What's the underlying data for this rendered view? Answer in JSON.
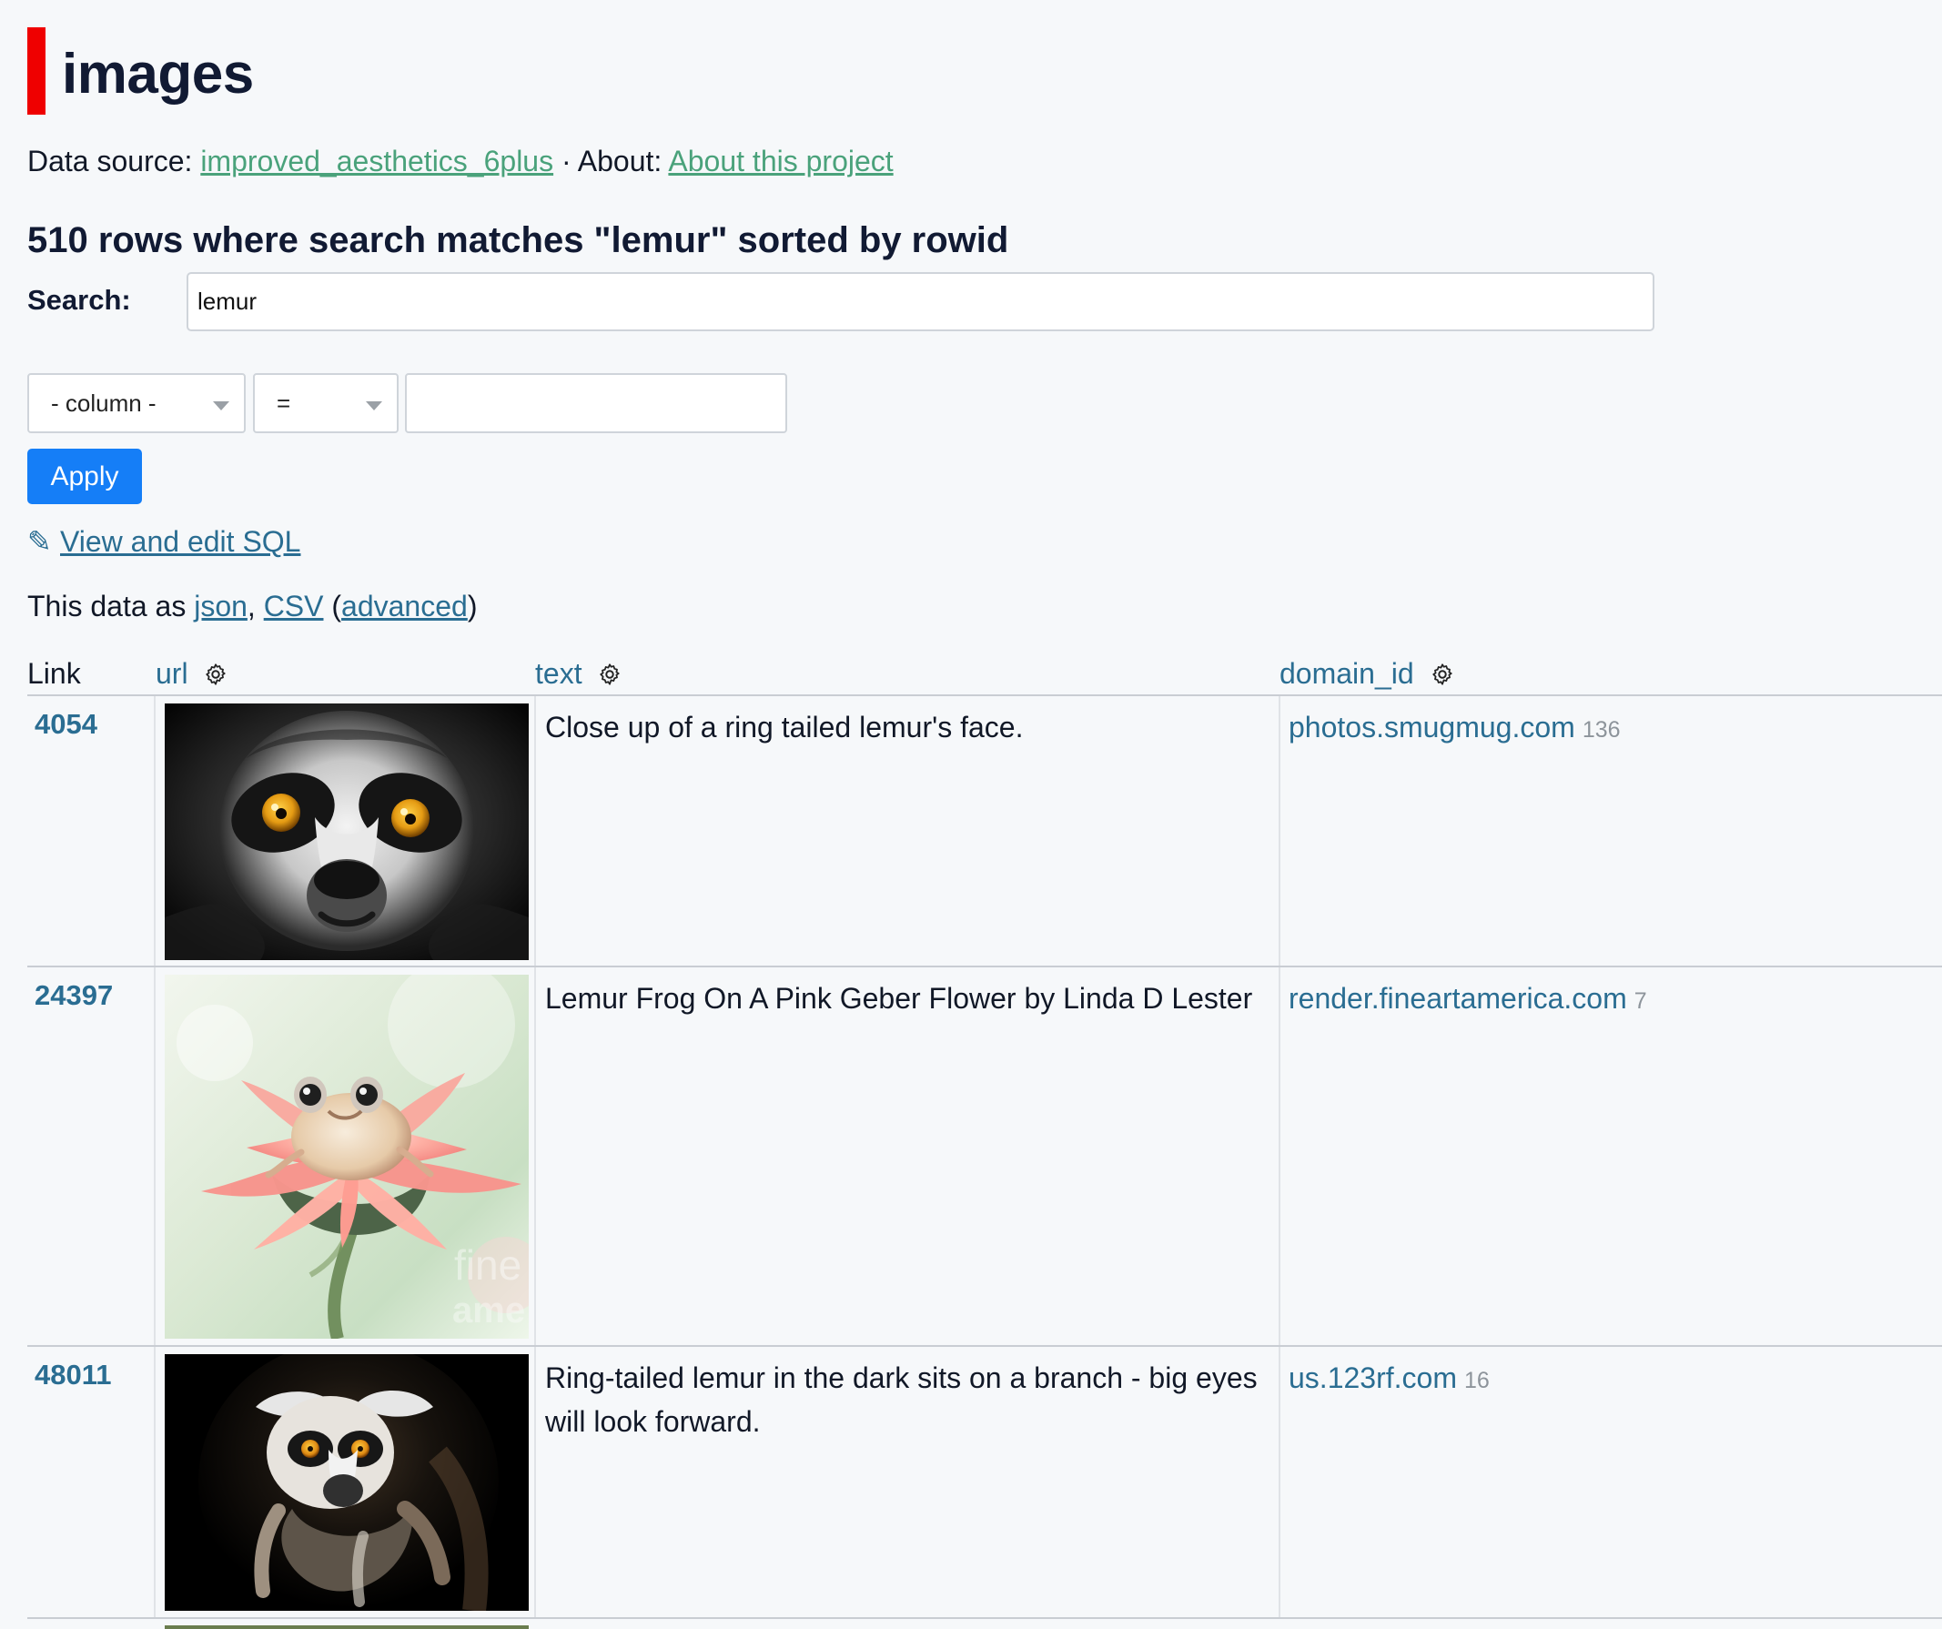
{
  "header": {
    "title": "images",
    "data_source_prefix": "Data source:",
    "data_source_link": "improved_aesthetics_6plus",
    "separator": "·",
    "about_prefix": "About:",
    "about_link": "About this project"
  },
  "summary": "510 rows where search matches \"lemur\" sorted by rowid",
  "search": {
    "label": "Search:",
    "value": "lemur"
  },
  "filter": {
    "column_select": "- column -",
    "operator_select": "=",
    "value": "",
    "apply_label": "Apply"
  },
  "links": {
    "sql_label": "View and edit SQL",
    "pencil_icon": "pencil-icon",
    "export_prefix": "This data as",
    "json": "json",
    "comma": ",",
    "csv": "CSV",
    "open_paren": "(",
    "advanced": "advanced",
    "close_paren": ")"
  },
  "table": {
    "columns": [
      {
        "label": "Link"
      },
      {
        "label": "url",
        "icon": "gear-icon"
      },
      {
        "label": "text",
        "icon": "gear-icon"
      },
      {
        "label": "domain_id",
        "icon": "gear-icon"
      }
    ],
    "rows": [
      {
        "id": "4054",
        "image_subject": "ring tailed lemur face close up",
        "text": "Close up of a ring tailed lemur's face.",
        "domain": "photos.smugmug.com",
        "domain_id": "136"
      },
      {
        "id": "24397",
        "image_subject": "frog on a pink gerbera flower",
        "text": "Lemur Frog On A Pink Geber Flower by Linda D Lester",
        "domain": "render.fineartamerica.com",
        "domain_id": "7"
      },
      {
        "id": "48011",
        "image_subject": "ring-tailed lemur in the dark",
        "text": "Ring-tailed lemur in the dark sits on a branch - big eyes will look forward.",
        "domain": "us.123rf.com",
        "domain_id": "16"
      }
    ]
  },
  "colors": {
    "accent_bar": "#ef0000",
    "link": "#2a6d92",
    "source_link": "#4aa27b",
    "button": "#157ef7",
    "background": "#f6f8fa"
  }
}
